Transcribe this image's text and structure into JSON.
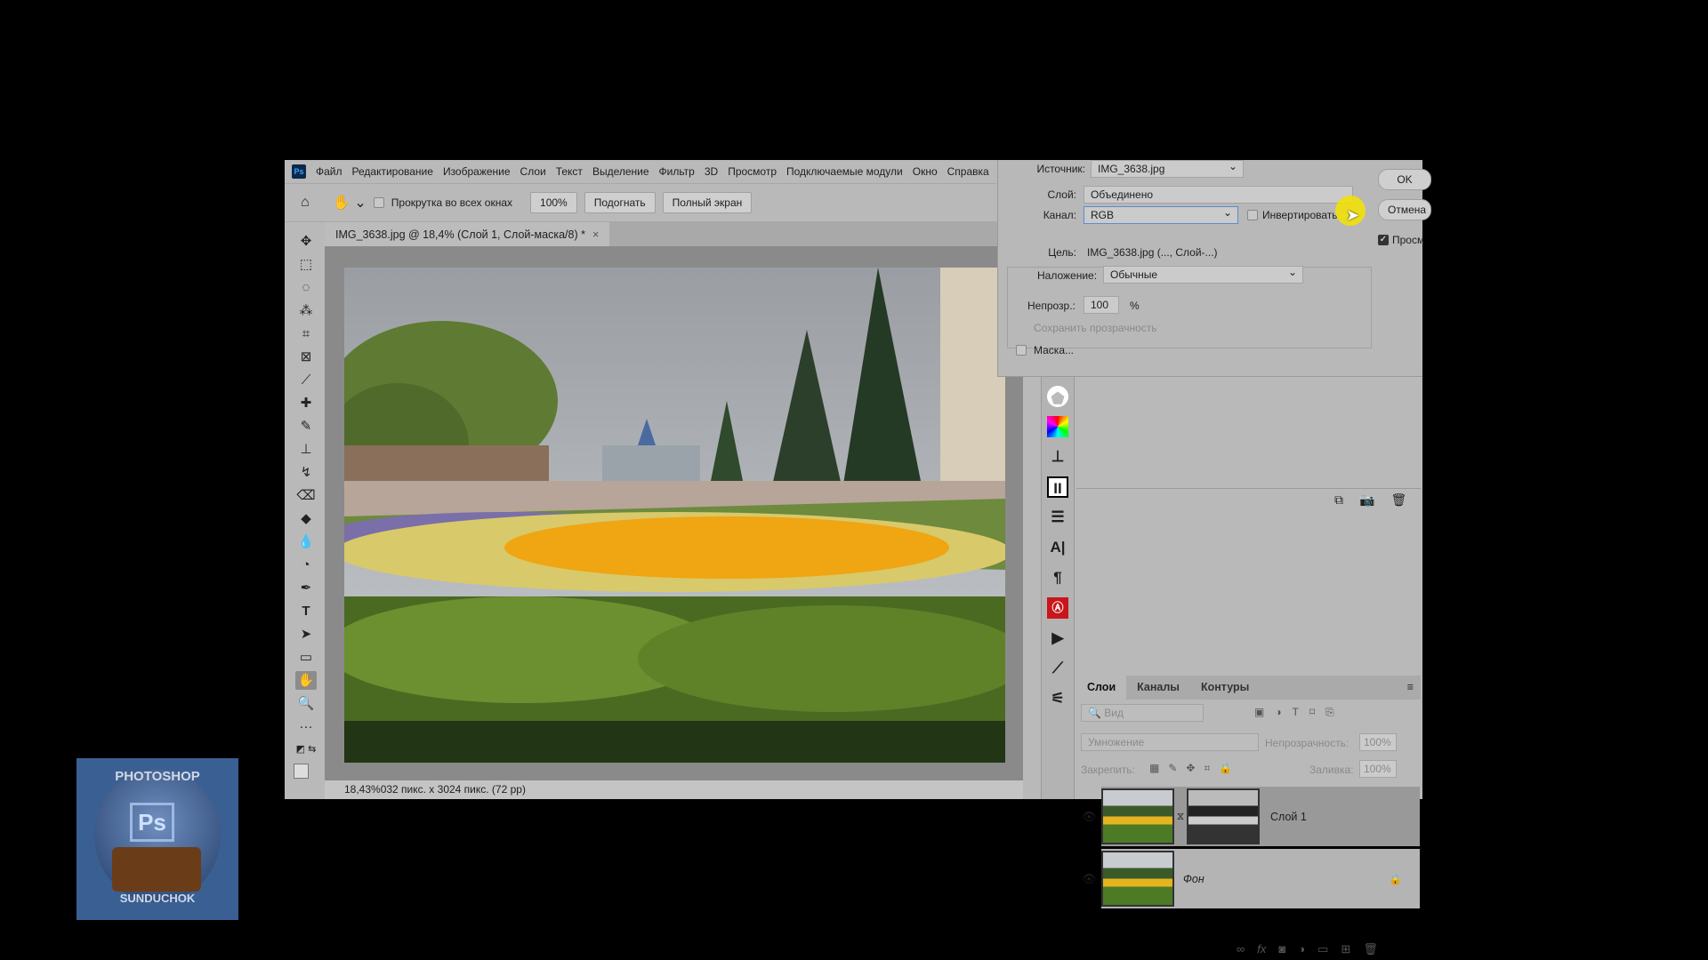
{
  "menu": {
    "items": [
      "Файл",
      "Редактирование",
      "Изображение",
      "Слои",
      "Текст",
      "Выделение",
      "Фильтр",
      "3D",
      "Просмотр",
      "Подключаемые модули",
      "Окно",
      "Справка"
    ]
  },
  "options": {
    "scroll_all_label": "Прокрутка во всех окнах",
    "scroll_all_checked": false,
    "zoom100": "100%",
    "fit": "Подогнать",
    "fullscreen": "Полный экран"
  },
  "document": {
    "tab_title": "IMG_3638.jpg @ 18,4% (Слой 1, Слой-маска/8) *",
    "close": "×",
    "status": "18,43%032 пикс. x 3024 пикс. (72 pp)"
  },
  "dialog": {
    "source_label": "Источник:",
    "source_value": "IMG_3638.jpg",
    "layer_label": "Слой:",
    "layer_value": "Объединено",
    "channel_label": "Канал:",
    "channel_value": "RGB",
    "invert_label": "Инвертировать",
    "invert_checked": false,
    "target_label": "Цель:",
    "target_value": "IMG_3638.jpg (..., Слой-...)",
    "blending_label": "Наложение:",
    "blending_value": "Обычные",
    "opacity_label": "Непрозр.:",
    "opacity_value": "100",
    "opacity_unit": "%",
    "preserve_label": "Сохранить прозрачность",
    "mask_label": "Маска...",
    "mask_checked": false,
    "ok": "OK",
    "cancel": "Отмена",
    "preview_label": "Просмотр",
    "preview_checked": true
  },
  "layers_panel": {
    "tabs": [
      "Слои",
      "Каналы",
      "Контуры"
    ],
    "active_tab": "Слои",
    "search_placeholder": "Вид",
    "blend_mode": "Умножение",
    "opacity_label": "Непрозрачность:",
    "opacity_value": "100%",
    "lock_label": "Закрепить:",
    "fill_label": "Заливка:",
    "fill_value": "100%",
    "layers": [
      {
        "name": "Слой 1",
        "visible": true,
        "has_mask": true,
        "selected": true
      },
      {
        "name": "Фон",
        "visible": true,
        "locked": true,
        "selected": false
      }
    ]
  },
  "watermark": {
    "text_top": "PHOTOSHOP",
    "text_bottom": "SUNDUCHOK",
    "badge": "Ps"
  },
  "colors": {
    "accent_cursor": "#f3e300",
    "ui_bg": "#b9b9b9"
  }
}
